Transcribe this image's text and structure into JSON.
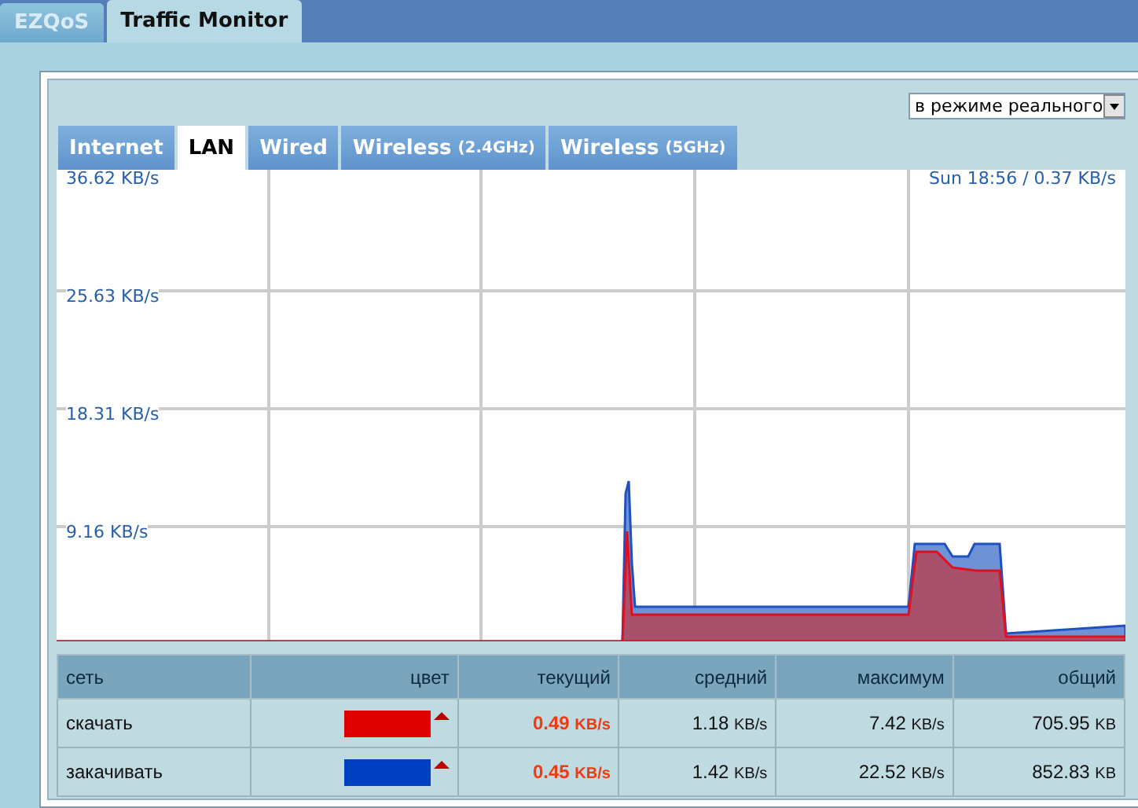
{
  "top_tabs": [
    {
      "label": "EZQoS",
      "selected": false
    },
    {
      "label": "Traffic Monitor",
      "selected": true
    }
  ],
  "mode_select": {
    "value": "в режиме реального"
  },
  "interface_tabs": [
    {
      "label": "Internet",
      "selected": false
    },
    {
      "label": "LAN",
      "selected": true
    },
    {
      "label": "Wired",
      "selected": false
    },
    {
      "label": "Wireless",
      "suffix": "(2.4GHz)",
      "selected": false
    },
    {
      "label": "Wireless",
      "suffix": "(5GHz)",
      "selected": false
    }
  ],
  "graph": {
    "y_labels": [
      "36.62 KB/s",
      "25.63 KB/s",
      "18.31 KB/s",
      "9.16 KB/s"
    ],
    "cursor_readout": "Sun 18:56 / 0.37 KB/s"
  },
  "table": {
    "columns": [
      "сеть",
      "цвет",
      "текущий",
      "средний",
      "максимум",
      "общий"
    ],
    "rows": [
      {
        "name": "скачать",
        "color": "#e00000",
        "current": "0.49",
        "current_unit": "KB/s",
        "average": "1.18",
        "average_unit": "KB/s",
        "max": "7.42",
        "max_unit": "KB/s",
        "total": "705.95",
        "total_unit": "KB"
      },
      {
        "name": "закачивать",
        "color": "#0040c0",
        "current": "0.45",
        "current_unit": "KB/s",
        "average": "1.42",
        "average_unit": "KB/s",
        "max": "22.52",
        "max_unit": "KB/s",
        "total": "852.83",
        "total_unit": "KB"
      }
    ]
  }
}
